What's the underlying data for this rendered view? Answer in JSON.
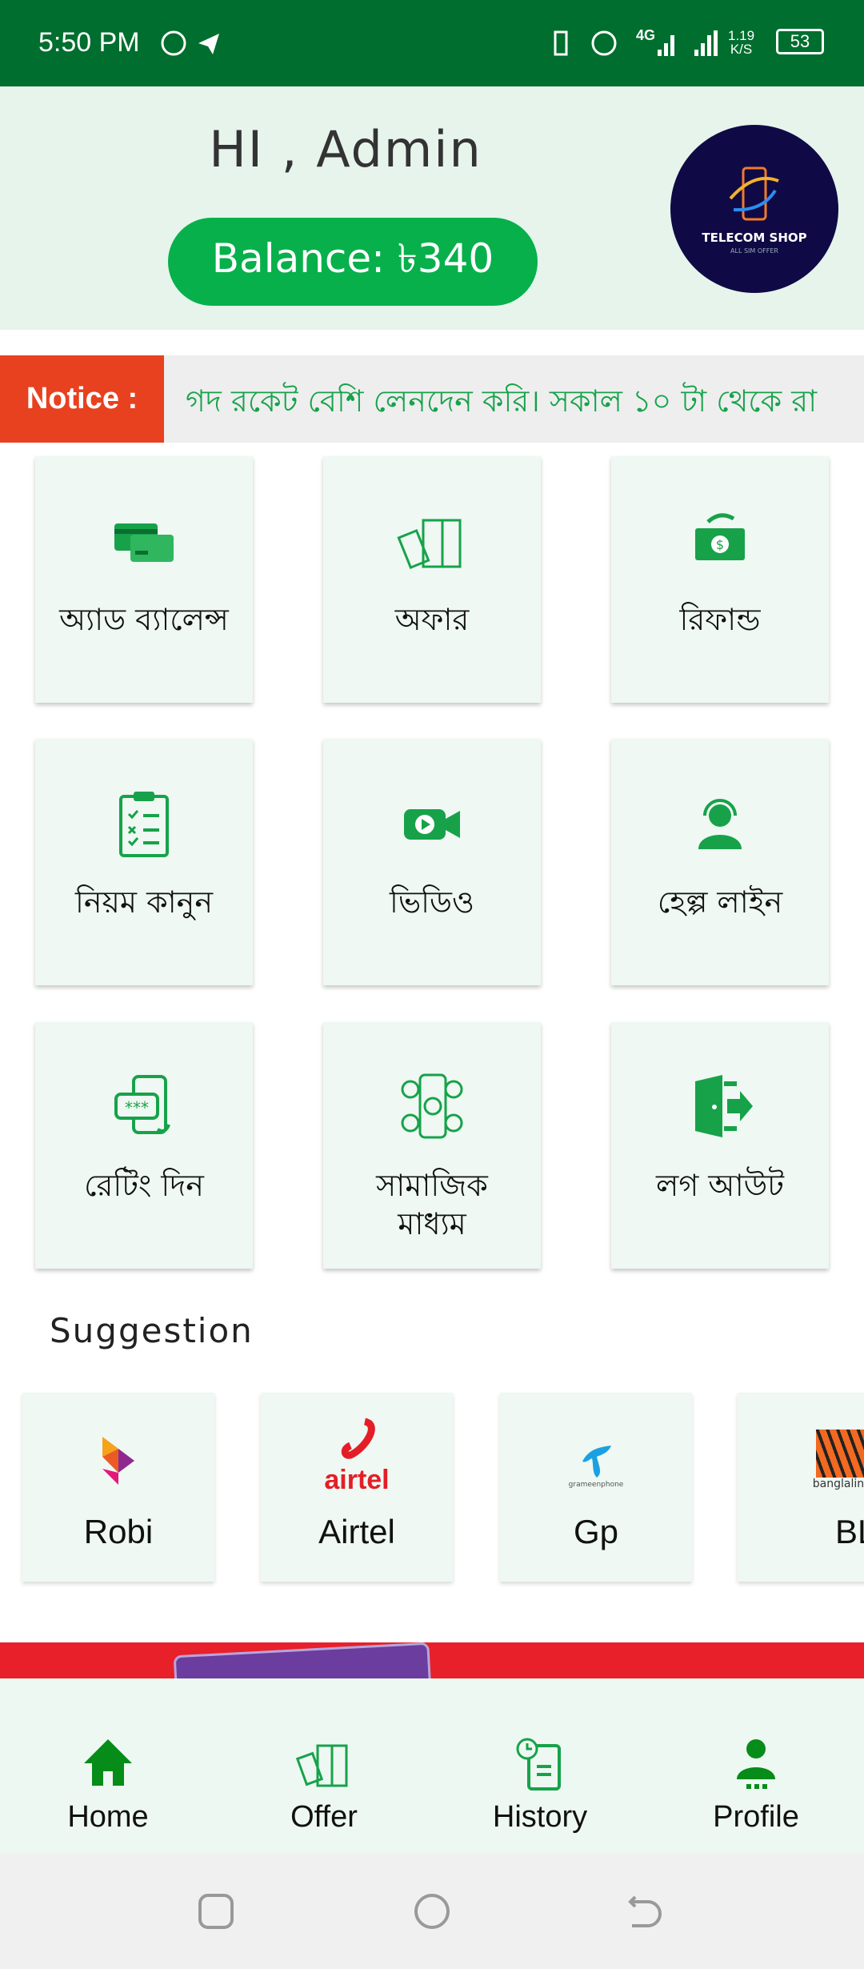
{
  "status_bar": {
    "time": "5:50 PM",
    "network": "4G",
    "speed_value": "1.19",
    "speed_unit": "K/S",
    "battery": "53"
  },
  "header": {
    "greeting": "HI , Admin",
    "balance": "Balance: ৳340",
    "logo_text": "TELECOM SHOP",
    "logo_subtext": "ALL SIM OFFER"
  },
  "notice": {
    "label": "Notice :",
    "text": "গদ রকেট বেশি লেনদেন করি। সকাল ১০ টা থেকে রা"
  },
  "menu": [
    {
      "label": "অ্যাড ব্যালেন্স",
      "icon": "credit-card-icon"
    },
    {
      "label": "অফার",
      "icon": "gift-offer-icon"
    },
    {
      "label": "রিফান্ড",
      "icon": "refund-money-icon"
    },
    {
      "label": "নিয়ম কানুন",
      "icon": "clipboard-checklist-icon"
    },
    {
      "label": "ভিডিও",
      "icon": "video-camera-icon"
    },
    {
      "label": "হেল্প লাইন",
      "icon": "headset-support-icon"
    },
    {
      "label": "রেটিং দিন",
      "icon": "rating-phone-icon"
    },
    {
      "label": "সামাজিক মাধ্যম",
      "icon": "social-media-icon"
    },
    {
      "label": "লগ আউট",
      "icon": "logout-door-icon"
    }
  ],
  "suggestion": {
    "title": "Suggestion",
    "operators": [
      {
        "name": "Robi",
        "logo_text": "Robi"
      },
      {
        "name": "Airtel",
        "logo_text": "airtel"
      },
      {
        "name": "Gp",
        "logo_text": "grameenphone"
      },
      {
        "name": "BL",
        "logo_text": "banglalink"
      }
    ]
  },
  "bottom_nav": [
    {
      "label": "Home",
      "icon": "home-icon",
      "active": true
    },
    {
      "label": "Offer",
      "icon": "gift-offer-icon"
    },
    {
      "label": "History",
      "icon": "history-icon"
    },
    {
      "label": "Profile",
      "icon": "profile-icon"
    }
  ],
  "colors": {
    "status_bar": "#006e2e",
    "accent": "#07b04b",
    "notice_label": "#e8411f",
    "card_bg": "#eff8f3"
  }
}
